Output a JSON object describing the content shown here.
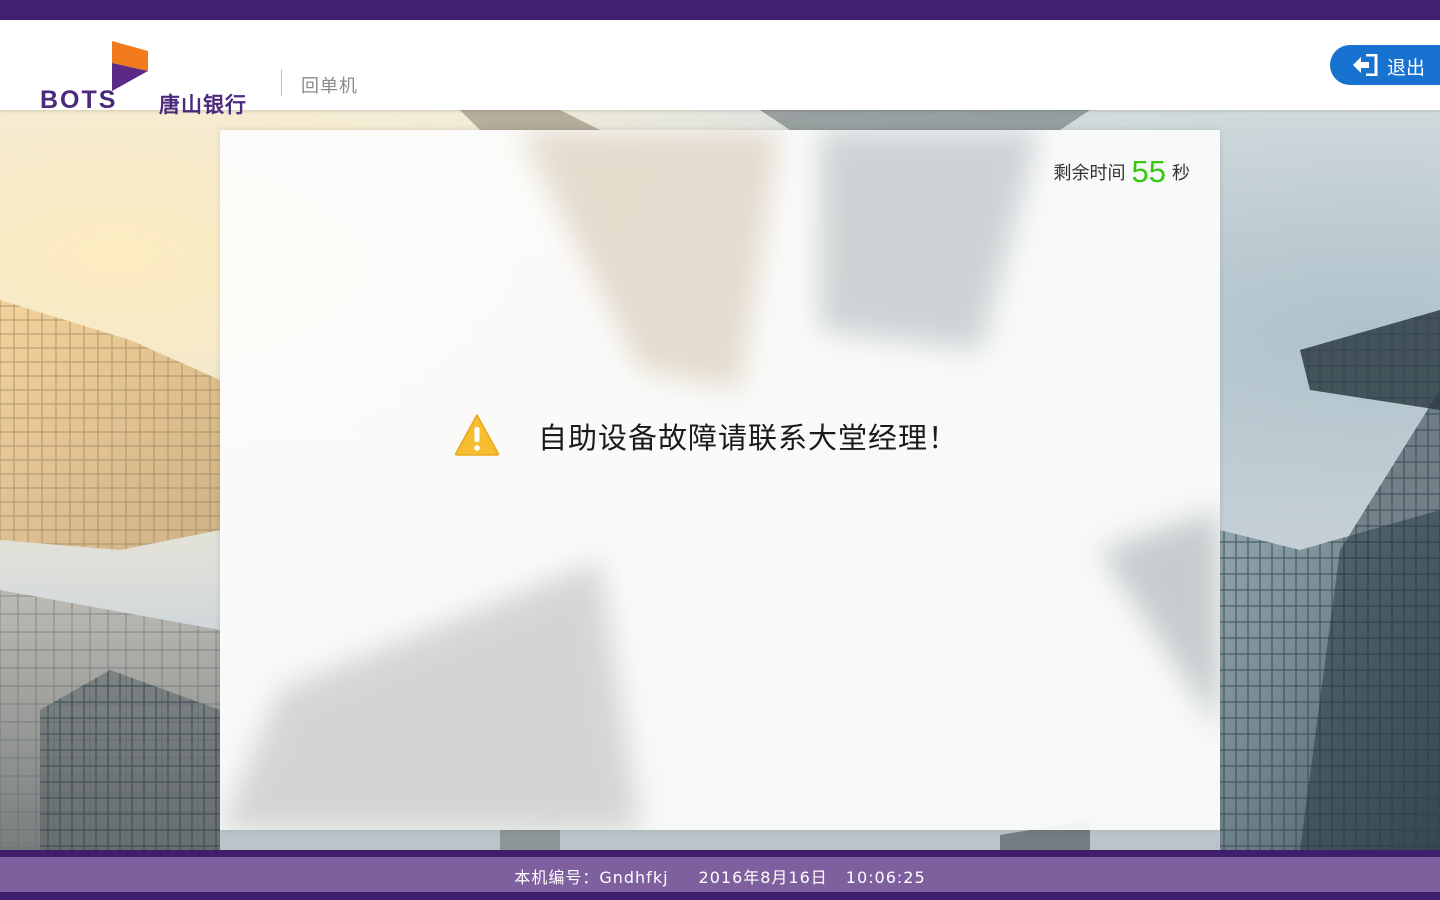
{
  "header": {
    "logo_bots": "BOTS",
    "logo_cn": "唐山银行",
    "app_name": "回单机",
    "exit_label": "退出"
  },
  "panel": {
    "countdown_prefix": "剩余时间",
    "countdown_value": "55",
    "countdown_unit": "秒",
    "message": "自助设备故障请联系大堂经理！",
    "warning_icon": "warning-triangle-icon"
  },
  "footer": {
    "machine_label": "本机编号：",
    "machine_id": "Gndhfkj",
    "date": "2016年8月16日",
    "time": "10:06:25"
  },
  "colors": {
    "brand_purple": "#42206f",
    "footer_purple": "#7e609f",
    "exit_blue": "#1872cf",
    "countdown_green": "#35c90d",
    "warning_yellow": "#f6bd2e",
    "logo_orange": "#f0781e"
  }
}
